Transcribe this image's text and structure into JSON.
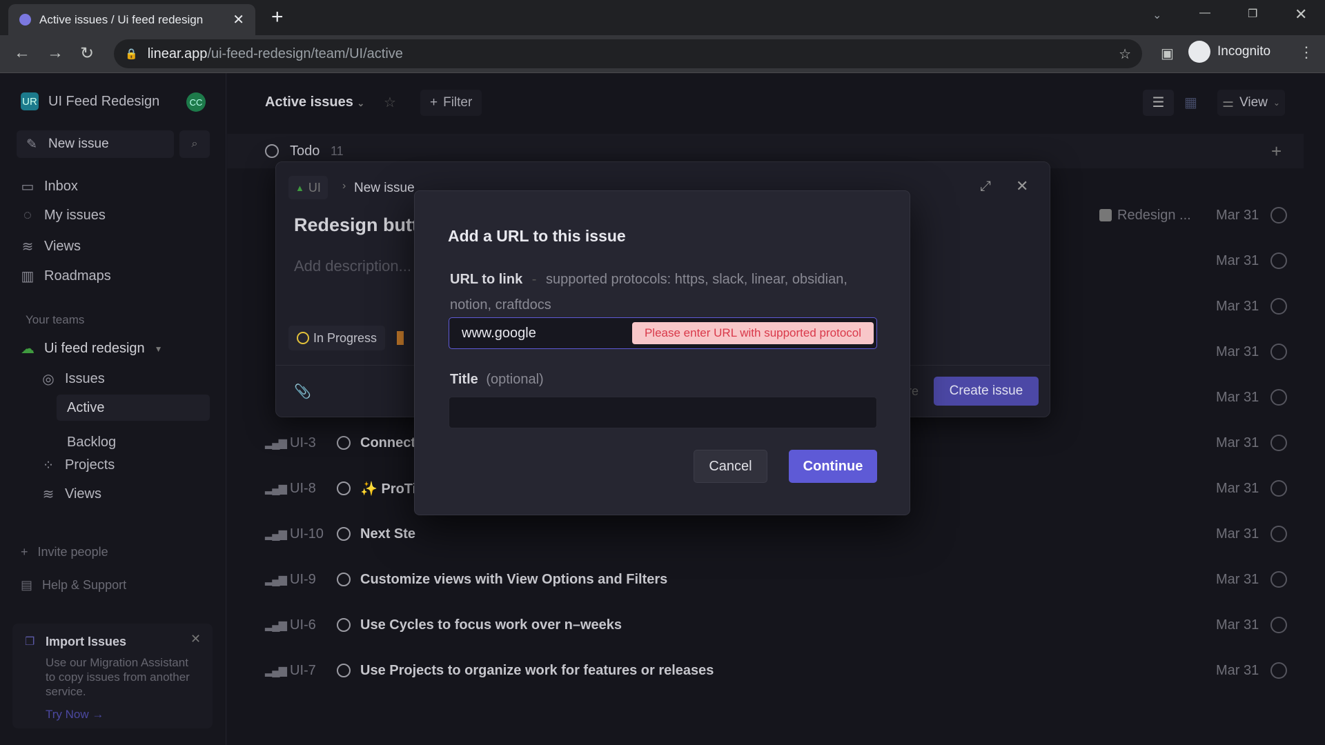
{
  "browser": {
    "tab_title": "Active issues / Ui feed redesign",
    "url_host": "linear.app",
    "url_path": "/ui-feed-redesign/team/UI/active",
    "profile": "Incognito"
  },
  "sidebar": {
    "workspace": "UI Feed Redesign",
    "workspace_initials": "UR",
    "user_initials": "CC",
    "new_issue": "New issue",
    "nav": [
      {
        "label": "Inbox"
      },
      {
        "label": "My issues"
      },
      {
        "label": "Views"
      },
      {
        "label": "Roadmaps"
      }
    ],
    "teams_heading": "Your teams",
    "team": "Ui feed redesign",
    "team_items": [
      {
        "label": "Issues"
      },
      {
        "label": "Active"
      },
      {
        "label": "Backlog"
      },
      {
        "label": "Projects"
      },
      {
        "label": "Views"
      }
    ],
    "invite": "Invite people",
    "help": "Help & Support",
    "import": {
      "title": "Import Issues",
      "body": "Use our Migration Assistant to copy issues from another service.",
      "link": "Try Now →"
    }
  },
  "header": {
    "title": "Active issues",
    "filter": "Filter",
    "view": "View"
  },
  "group": {
    "name": "Todo",
    "count": "11"
  },
  "rows": [
    {
      "id": "",
      "title": "",
      "project": "Redesign ...",
      "date": "Mar 31"
    },
    {
      "id": "",
      "title": "",
      "date": "Mar 31"
    },
    {
      "id": "",
      "title": "",
      "date": "Mar 31"
    },
    {
      "id": "",
      "title": "",
      "date": "Mar 31"
    },
    {
      "id": "",
      "title": "",
      "date": "Mar 31"
    },
    {
      "id": "UI-3",
      "title": "Connect",
      "date": "Mar 31"
    },
    {
      "id": "UI-8",
      "title": "✨ ProTi",
      "date": "Mar 31"
    },
    {
      "id": "UI-10",
      "title": "Next Ste",
      "date": "Mar 31"
    },
    {
      "id": "UI-9",
      "title": "Customize views with View Options and Filters",
      "date": "Mar 31"
    },
    {
      "id": "UI-6",
      "title": "Use Cycles to focus work over n–weeks",
      "date": "Mar 31"
    },
    {
      "id": "UI-7",
      "title": "Use Projects to organize work for features or releases",
      "date": "Mar 31"
    }
  ],
  "new_issue_panel": {
    "team": "UI",
    "breadcrumb": "New issue",
    "title": "Redesign butt",
    "description_placeholder": "Add description...",
    "status": "In Progress",
    "create": "Create issue",
    "hidden_label": "re"
  },
  "url_dialog": {
    "title": "Add a URL to this issue",
    "url_label": "URL to link",
    "url_hint": "supported protocols: https, slack, linear, obsidian, notion, craftdocs",
    "url_value": "www.google",
    "error": "Please enter URL with supported protocol",
    "title_label": "Title",
    "title_hint": "(optional)",
    "title_value": "",
    "cancel": "Cancel",
    "continue": "Continue"
  },
  "colors": {
    "accent": "#5e5ad6",
    "error_bg": "#f8c7c9",
    "error_text": "#d9394a",
    "status_in_progress": "#e2c13a"
  }
}
